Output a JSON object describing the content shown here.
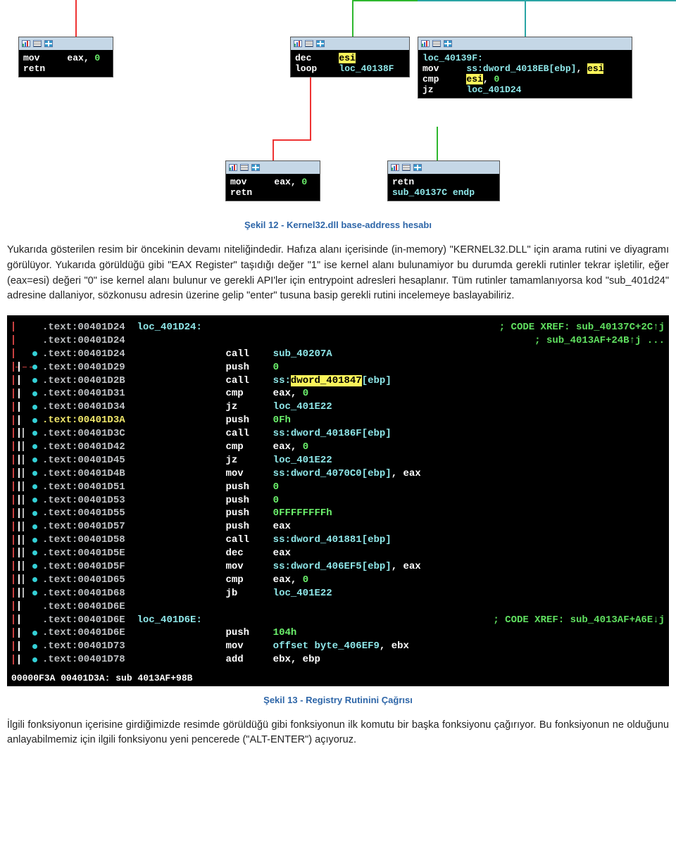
{
  "graph": {
    "box1": {
      "l1": "mov     eax, ",
      "l1v": "0",
      "l2": "retn"
    },
    "box2": {
      "l1a": "dec     ",
      "l1b": "esi",
      "l2a": "loop    ",
      "l2b": "loc_40138F"
    },
    "box3": {
      "l1": "loc_40139F:",
      "l2a": "mov     ",
      "l2b": "ss:dword_4018EB[ebp]",
      "l2c": ", ",
      "l2d": "esi",
      "l3a": "cmp     ",
      "l3b": "esi",
      "l3c": ", ",
      "l3d": "0",
      "l4a": "jz      ",
      "l4b": "loc_401D24"
    },
    "box4": {
      "l1": "mov     eax, ",
      "l1v": "0",
      "l2": "retn"
    },
    "box5": {
      "l1": "retn",
      "l2": "sub_40137C endp"
    }
  },
  "caption1": "Şekil 12 - Kernel32.dll base-address hesabı",
  "para1": "Yukarıda gösterilen resim bir öncekinin devamı niteliğindedir. Hafıza alanı içerisinde (in-memory) \"KERNEL32.DLL\" için arama rutini ve diyagramı görülüyor. Yukarıda görüldüğü gibi \"EAX Register\" taşıdığı değer \"1\" ise kernel alanı bulunamiyor bu durumda gerekli rutinler tekrar işletilir, eğer (eax=esi) değeri \"0\" ise kernel alanı bulunur ve gerekli API'ler için entrypoint adresleri hesaplanır. Tüm rutinler tamamlanıyorsa kod \"sub_401d24\" adresine dallaniyor, sözkonusu adresin üzerine gelip \"enter\" tusuna basip gerekli rutini incelemeye baslayabiliriz.",
  "asm": {
    "lines": [
      {
        "addr": ".text:00401D24 ",
        "label": "loc_401D24:",
        "xref": "; CODE XREF: sub_40137C+2C↑j"
      },
      {
        "addr": ".text:00401D24",
        "xref2": "; sub_4013AF+24B↑j ..."
      },
      {
        "addr": ".text:00401D24",
        "op": "call    ",
        "arg": "sub_40207A"
      },
      {
        "addr": ".text:00401D29",
        "op": "push    ",
        "num": "0"
      },
      {
        "addr": ".text:00401D2B",
        "op": "call    ",
        "pre": "ss:",
        "hl": "dword_401847",
        "post": "[ebp]"
      },
      {
        "addr": ".text:00401D31",
        "op": "cmp     ",
        "reg": "eax",
        "sep": ", ",
        "num": "0"
      },
      {
        "addr": ".text:00401D34",
        "op": "jz      ",
        "arg": "loc_401E22"
      },
      {
        "addrY": ".text:00401D3A",
        "op": "push    ",
        "num": "0Fh"
      },
      {
        "addr": ".text:00401D3C",
        "op": "call    ",
        "cy": "ss:dword_40186F[ebp]"
      },
      {
        "addr": ".text:00401D42",
        "op": "cmp     ",
        "reg": "eax",
        "sep": ", ",
        "num": "0"
      },
      {
        "addr": ".text:00401D45",
        "op": "jz      ",
        "arg": "loc_401E22"
      },
      {
        "addr": ".text:00401D4B",
        "op": "mov     ",
        "cy": "ss:dword_4070C0[ebp]",
        "sep": ", ",
        "reg": "eax"
      },
      {
        "addr": ".text:00401D51",
        "op": "push    ",
        "num": "0"
      },
      {
        "addr": ".text:00401D53",
        "op": "push    ",
        "num": "0"
      },
      {
        "addr": ".text:00401D55",
        "op": "push    ",
        "num": "0FFFFFFFFh"
      },
      {
        "addr": ".text:00401D57",
        "op": "push    ",
        "reg": "eax"
      },
      {
        "addr": ".text:00401D58",
        "op": "call    ",
        "cy": "ss:dword_401881[ebp]"
      },
      {
        "addr": ".text:00401D5E",
        "op": "dec     ",
        "reg": "eax"
      },
      {
        "addr": ".text:00401D5F",
        "op": "mov     ",
        "cy": "ss:dword_406EF5[ebp]",
        "sep": ", ",
        "reg": "eax"
      },
      {
        "addr": ".text:00401D65",
        "op": "cmp     ",
        "reg": "eax",
        "sep": ", ",
        "num": "0"
      },
      {
        "addr": ".text:00401D68",
        "op": "jb      ",
        "arg": "loc_401E22"
      },
      {
        "addr": ".text:00401D6E"
      },
      {
        "addr": ".text:00401D6E ",
        "label": "loc_401D6E:",
        "xref": "; CODE XREF: sub_4013AF+A6E↓j"
      },
      {
        "addr": ".text:00401D6E",
        "op": "push    ",
        "num": "104h"
      },
      {
        "addr": ".text:00401D73",
        "op": "mov     ",
        "reg": "ebx",
        "sep": ", ",
        "cy": "offset byte_406EF9"
      },
      {
        "addr": ".text:00401D78",
        "op": "add     ",
        "reg": "ebx",
        "sep": ", ",
        "reg2": "ebp"
      }
    ],
    "status": "00000F3A 00401D3A: sub 4013AF+98B"
  },
  "caption2": "Şekil 13 - Registry Rutinini Çağrısı",
  "para2": "İlgili fonksiyonun içerisine girdiğimizde resimde görüldüğü gibi fonksiyonun ilk komutu bir başka fonksiyonu çağırıyor. Bu fonksiyonun ne olduğunu anlayabilmemiz için ilgili fonksiyonu yeni pencerede (\"ALT-ENTER\")  açıyoruz."
}
